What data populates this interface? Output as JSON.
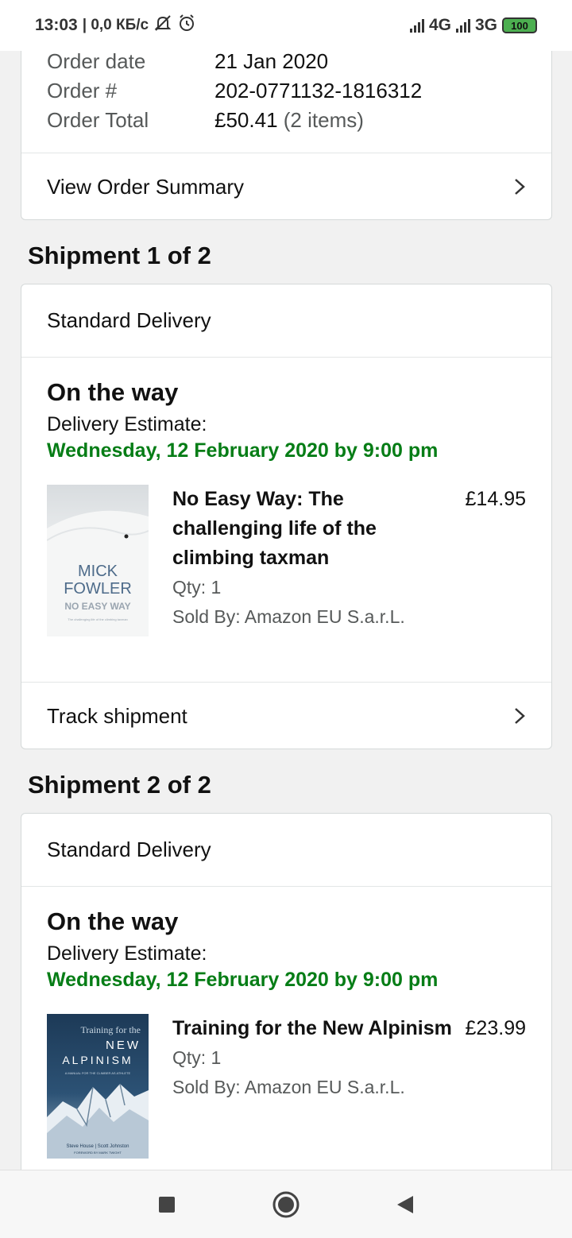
{
  "status_bar": {
    "time": "13:03",
    "speed": "| 0,0 КБ/с",
    "network1": "4G",
    "network2": "3G",
    "battery": "100"
  },
  "order": {
    "date_label": "Order date",
    "date_value": "21 Jan 2020",
    "number_label": "Order #",
    "number_value": "202-0771132-1816312",
    "total_label": "Order Total",
    "total_value": "£50.41",
    "total_items": "(2 items)",
    "view_summary": "View Order Summary"
  },
  "shipments": [
    {
      "heading": "Shipment 1 of 2",
      "delivery_type": "Standard Delivery",
      "status": "On the way",
      "estimate_label": "Delivery Estimate:",
      "estimate_date": "Wednesday, 12 February 2020 by 9:00 pm",
      "item": {
        "title": "No Easy Way: The challenging life of the climbing taxman",
        "price": "£14.95",
        "qty": "Qty: 1",
        "seller": "Sold By: Amazon EU S.a.r.L.",
        "cover": {
          "line1": "MICK",
          "line2": "FOWLER",
          "line3": "NO EASY WAY",
          "line4": "The challenging life of the climbing taxman"
        }
      },
      "track": "Track shipment"
    },
    {
      "heading": "Shipment 2 of 2",
      "delivery_type": "Standard Delivery",
      "status": "On the way",
      "estimate_label": "Delivery Estimate:",
      "estimate_date": "Wednesday, 12 February 2020 by 9:00 pm",
      "item": {
        "title": "Training for the New Alpinism",
        "price": "£23.99",
        "qty": "Qty: 1",
        "seller": "Sold By: Amazon EU S.a.r.L.",
        "cover": {
          "line1": "Training for the",
          "line2": "NEW",
          "line3": "ALPINISM",
          "line4": "A MANUAL FOR THE CLIMBER AS ATHLETE",
          "line5": "Steve House | Scott Johnston",
          "line6": "FOREWORD BY MARK TWIGHT"
        }
      }
    }
  ],
  "colors": {
    "estimate_green": "#067d16",
    "border": "#d5d9d9",
    "muted_text": "#565959"
  },
  "icons": {
    "chevron": "chevron-right-icon",
    "nav_recents": "square-icon",
    "nav_home": "circle-icon",
    "nav_back": "triangle-back-icon"
  }
}
